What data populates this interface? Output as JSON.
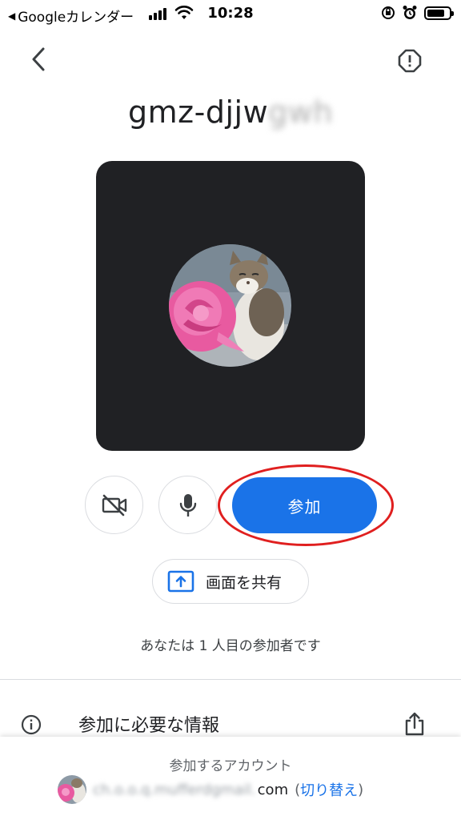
{
  "status_bar": {
    "back_app": "Googleカレンダー",
    "time": "10:28",
    "battery_level": 0.8
  },
  "header": {
    "back_icon": "chevron-left-icon",
    "report_icon": "alert-octagon-icon",
    "meeting_code_visible": "gmz-djjw",
    "meeting_code_masked": "gwh"
  },
  "controls": {
    "camera_icon": "video-off-icon",
    "mic_icon": "microphone-icon",
    "join_label": "参加",
    "share_screen_label": "画面を共有",
    "share_screen_icon": "present-to-all-icon"
  },
  "participant_note": "あなたは 1 人目の参加者です",
  "info": {
    "label": "参加に必要な情報",
    "info_icon": "info-icon",
    "share_icon": "share-upload-icon"
  },
  "account": {
    "caption": "参加するアカウント",
    "email_masked": "ch.o.o.q.mufferdgmail.",
    "email_suffix": "com",
    "paren_open": "(",
    "switch_label": "切り替え",
    "paren_close": ")"
  },
  "colors": {
    "accent": "#1a73e8",
    "preview_bg": "#202124",
    "highlight": "#e01f1f"
  }
}
